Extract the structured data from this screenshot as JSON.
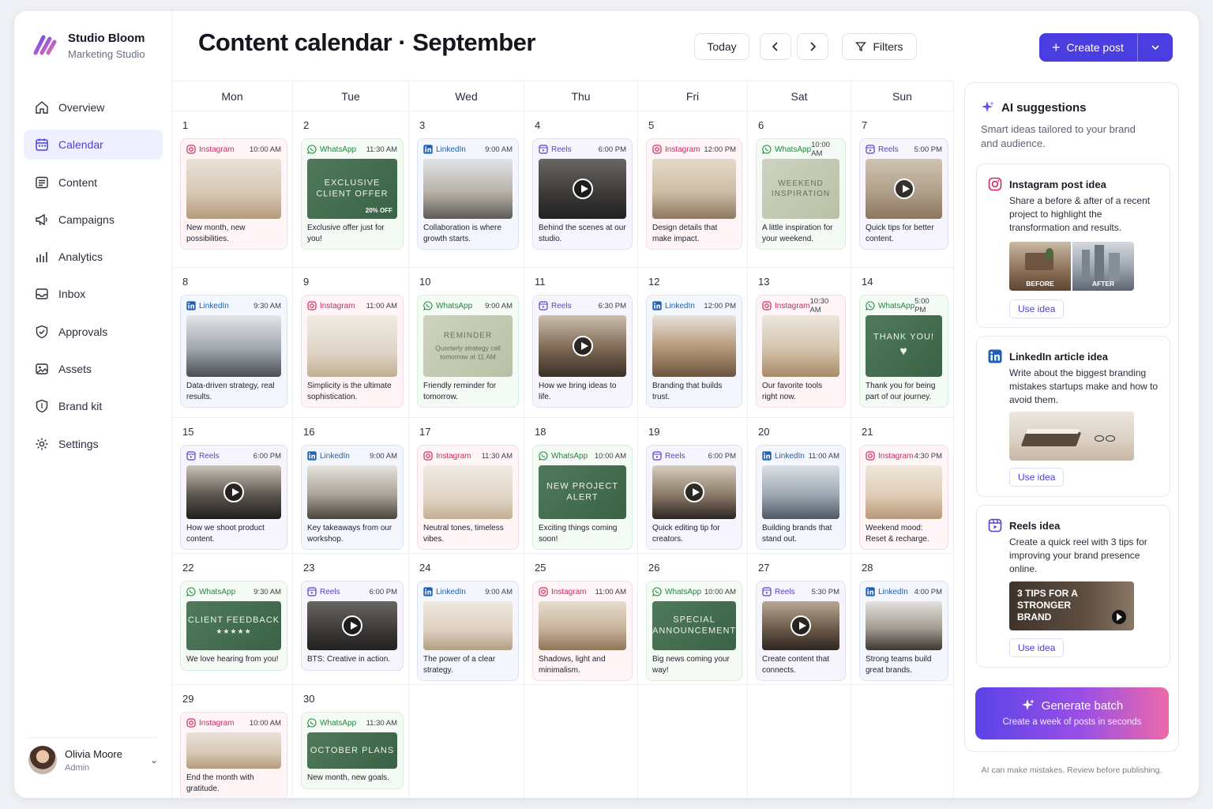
{
  "brand": {
    "name": "Studio Bloom",
    "subtitle": "Marketing Studio"
  },
  "nav": [
    {
      "label": "Overview",
      "icon": "home-icon",
      "active": false
    },
    {
      "label": "Calendar",
      "icon": "calendar-icon",
      "active": true
    },
    {
      "label": "Content",
      "icon": "content-icon",
      "active": false
    },
    {
      "label": "Campaigns",
      "icon": "megaphone-icon",
      "active": false
    },
    {
      "label": "Analytics",
      "icon": "bar-chart-icon",
      "active": false
    },
    {
      "label": "Inbox",
      "icon": "inbox-icon",
      "active": false
    },
    {
      "label": "Approvals",
      "icon": "check-shield-icon",
      "active": false
    },
    {
      "label": "Assets",
      "icon": "image-icon",
      "active": false
    },
    {
      "label": "Brand kit",
      "icon": "shield-icon",
      "active": false
    },
    {
      "label": "Settings",
      "icon": "gear-icon",
      "active": false
    }
  ],
  "user": {
    "name": "Olivia Moore",
    "role": "Admin"
  },
  "header": {
    "title": "Content calendar · September",
    "today": "Today",
    "filters": "Filters",
    "create": "Create post"
  },
  "weekdays": [
    "Mon",
    "Tue",
    "Wed",
    "Thu",
    "Fri",
    "Sat",
    "Sun"
  ],
  "colors": {
    "instagram": "#d3275f",
    "whatsapp": "#1e8a3c",
    "linkedin": "#1c5fb5",
    "reels": "#5b3fcf",
    "accent": "#4b3ee0"
  },
  "posts": [
    {
      "day": "1",
      "platform": "Instagram",
      "type": "ig",
      "time": "10:00 AM",
      "caption": "New month, new possibilities.",
      "thumb": "photo-living"
    },
    {
      "day": "2",
      "platform": "WhatsApp",
      "type": "wa",
      "time": "11:30 AM",
      "caption": "Exclusive offer just for you!",
      "thumb": "green",
      "overlay": "EXCLUSIVE CLIENT OFFER",
      "badge": "20% OFF"
    },
    {
      "day": "3",
      "platform": "LinkedIn",
      "type": "li",
      "time": "9:00 AM",
      "caption": "Collaboration is where growth starts.",
      "thumb": "photo-meeting"
    },
    {
      "day": "4",
      "platform": "Reels",
      "type": "re",
      "time": "6:00 PM",
      "caption": "Behind the scenes at our studio.",
      "thumb": "photo-studio",
      "video": true
    },
    {
      "day": "5",
      "platform": "Instagram",
      "type": "ig",
      "time": "12:00 PM",
      "caption": "Design details that make impact.",
      "thumb": "photo-frames"
    },
    {
      "day": "6",
      "platform": "WhatsApp",
      "type": "wa",
      "time": "10:00 AM",
      "caption": "A little inspiration for your weekend.",
      "thumb": "sage",
      "overlay": "WEEKEND INSPIRATION"
    },
    {
      "day": "7",
      "platform": "Reels",
      "type": "re",
      "time": "5:00 PM",
      "caption": "Quick tips for better content.",
      "thumb": "photo-coffee",
      "video": true
    },
    {
      "day": "8",
      "platform": "LinkedIn",
      "type": "li",
      "time": "9:30 AM",
      "caption": "Data-driven strategy, real results.",
      "thumb": "photo-laptop"
    },
    {
      "day": "9",
      "platform": "Instagram",
      "type": "ig",
      "time": "11:00 AM",
      "caption": "Simplicity is the ultimate sophistication.",
      "thumb": "photo-vase"
    },
    {
      "day": "10",
      "platform": "WhatsApp",
      "type": "wa",
      "time": "9:00 AM",
      "caption": "Friendly reminder for tomorrow.",
      "thumb": "sage",
      "overlay": "REMINDER",
      "overlay2": "Quarterly strategy call tomorrow at 11 AM"
    },
    {
      "day": "11",
      "platform": "Reels",
      "type": "re",
      "time": "6:30 PM",
      "caption": "How we bring ideas to life.",
      "thumb": "photo-woman",
      "video": true
    },
    {
      "day": "12",
      "platform": "LinkedIn",
      "type": "li",
      "time": "12:00 PM",
      "caption": "Branding that builds trust.",
      "thumb": "photo-arch"
    },
    {
      "day": "13",
      "platform": "Instagram",
      "type": "ig",
      "time": "10:30 AM",
      "caption": "Our favorite tools right now.",
      "thumb": "photo-desk"
    },
    {
      "day": "14",
      "platform": "WhatsApp",
      "type": "wa",
      "time": "5:00 PM",
      "caption": "Thank you for being part of our journey.",
      "thumb": "green",
      "overlay": "THANK YOU!",
      "heart": true
    },
    {
      "day": "15",
      "platform": "Reels",
      "type": "re",
      "time": "6:00 PM",
      "caption": "How we shoot product content.",
      "thumb": "photo-camera",
      "video": true
    },
    {
      "day": "16",
      "platform": "LinkedIn",
      "type": "li",
      "time": "9:00 AM",
      "caption": "Key takeaways from our workshop.",
      "thumb": "photo-workshop"
    },
    {
      "day": "17",
      "platform": "Instagram",
      "type": "ig",
      "time": "11:30 AM",
      "caption": "Neutral tones, timeless vibes.",
      "thumb": "photo-vase"
    },
    {
      "day": "18",
      "platform": "WhatsApp",
      "type": "wa",
      "time": "10:00 AM",
      "caption": "Exciting things coming soon!",
      "thumb": "green",
      "overlay": "NEW PROJECT ALERT"
    },
    {
      "day": "19",
      "platform": "Reels",
      "type": "re",
      "time": "6:00 PM",
      "caption": "Quick editing tip for creators.",
      "thumb": "photo-photographer",
      "video": true
    },
    {
      "day": "20",
      "platform": "LinkedIn",
      "type": "li",
      "time": "11:00 AM",
      "caption": "Building brands that stand out.",
      "thumb": "photo-city"
    },
    {
      "day": "21",
      "platform": "Instagram",
      "type": "ig",
      "time": "4:30 PM",
      "caption": "Weekend mood: Reset & recharge.",
      "thumb": "photo-candles"
    },
    {
      "day": "22",
      "platform": "WhatsApp",
      "type": "wa",
      "time": "9:30 AM",
      "caption": "We love hearing from you!",
      "thumb": "green",
      "overlay": "CLIENT FEEDBACK",
      "stars": "★★★★★"
    },
    {
      "day": "23",
      "platform": "Reels",
      "type": "re",
      "time": "6:00 PM",
      "caption": "BTS: Creative in action.",
      "thumb": "photo-studio",
      "video": true
    },
    {
      "day": "24",
      "platform": "LinkedIn",
      "type": "li",
      "time": "9:00 AM",
      "caption": "The power of a clear strategy.",
      "thumb": "photo-writing"
    },
    {
      "day": "25",
      "platform": "Instagram",
      "type": "ig",
      "time": "11:00 AM",
      "caption": "Shadows, light and minimalism.",
      "thumb": "photo-plant"
    },
    {
      "day": "26",
      "platform": "WhatsApp",
      "type": "wa",
      "time": "10:00 AM",
      "caption": "Big news coming your way!",
      "thumb": "green",
      "overlay": "SPECIAL ANNOUNCEMENT"
    },
    {
      "day": "27",
      "platform": "Reels",
      "type": "re",
      "time": "5:30 PM",
      "caption": "Create content that connects.",
      "thumb": "photo-phone",
      "video": true
    },
    {
      "day": "28",
      "platform": "LinkedIn",
      "type": "li",
      "time": "4:00 PM",
      "caption": "Strong teams build great brands.",
      "thumb": "photo-team"
    },
    {
      "day": "29",
      "platform": "Instagram",
      "type": "ig",
      "time": "10:00 AM",
      "caption": "End the month with gratitude.",
      "thumb": "photo-living"
    },
    {
      "day": "30",
      "platform": "WhatsApp",
      "type": "wa",
      "time": "11:30 AM",
      "caption": "New month, new goals.",
      "thumb": "green",
      "overlay": "OCTOBER PLANS"
    }
  ],
  "ai": {
    "title": "AI suggestions",
    "subtitle": "Smart ideas tailored to your brand and audience.",
    "ideas": [
      {
        "title": "Instagram post idea",
        "icon": "instagram-icon",
        "text": "Share a before & after of a recent project to highlight the transformation and results.",
        "before": "BEFORE",
        "after": "AFTER",
        "button": "Use idea"
      },
      {
        "title": "LinkedIn article idea",
        "icon": "linkedin-icon",
        "text": "Write about the biggest branding mistakes startups make and how to avoid them.",
        "button": "Use idea"
      },
      {
        "title": "Reels idea",
        "icon": "reels-icon",
        "text": "Create a quick reel with 3 tips for improving your brand presence online.",
        "thumb_text": "3 TIPS FOR A STRONGER BRAND",
        "button": "Use idea"
      }
    ],
    "generate_title": "Generate batch",
    "generate_sub": "Create a week of posts in seconds",
    "disclaimer": "AI can make mistakes. Review before publishing."
  }
}
